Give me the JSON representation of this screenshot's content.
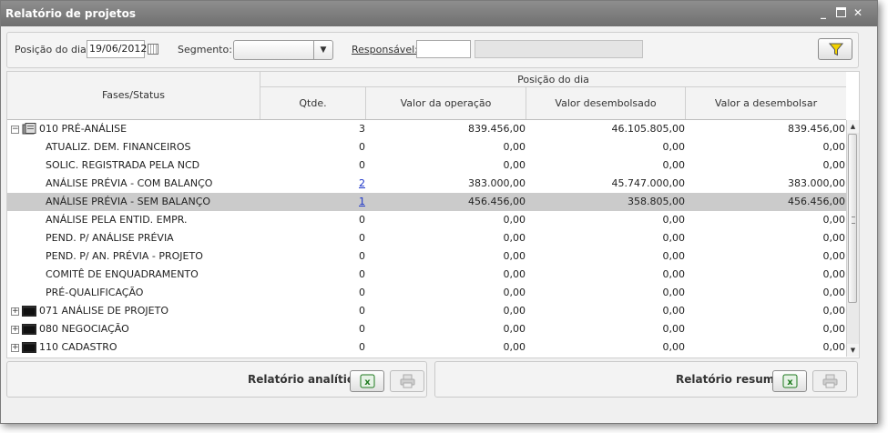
{
  "window": {
    "title": "Relatório de projetos"
  },
  "filters": {
    "posicao_label": "Posição do dia:",
    "posicao_value": "19/06/2012",
    "segmento_label": "Segmento:",
    "segmento_value": "",
    "responsavel_label": "Responsável:",
    "responsavel_code": "",
    "responsavel_name": ""
  },
  "grid": {
    "headers": {
      "fases": "Fases/Status",
      "posicao": "Posição do dia",
      "qtde": "Qtde.",
      "valor_operacao": "Valor da operação",
      "valor_desembolsado": "Valor desembolsado",
      "valor_a_desembolsar": "Valor a desembolsar"
    },
    "rows": [
      {
        "type": "group",
        "expander": "−",
        "name": "010 PRÉ-ANÁLISE",
        "qtde": "3",
        "op": "839.456,00",
        "des": "46.105.805,00",
        "ades": "839.456,00",
        "bold": true
      },
      {
        "type": "child",
        "name": "ATUALIZ. DEM. FINANCEIROS",
        "qtde": "0",
        "op": "0,00",
        "des": "0,00",
        "ades": "0,00"
      },
      {
        "type": "child",
        "name": "SOLIC. REGISTRADA PELA NCD",
        "qtde": "0",
        "op": "0,00",
        "des": "0,00",
        "ades": "0,00"
      },
      {
        "type": "child",
        "name": "ANÁLISE PRÉVIA - COM BALANÇO",
        "qtde": "2",
        "op": "383.000,00",
        "des": "45.747.000,00",
        "ades": "383.000,00",
        "link": true
      },
      {
        "type": "child",
        "name": "ANÁLISE PRÉVIA - SEM BALANÇO",
        "qtde": "1",
        "op": "456.456,00",
        "des": "358.805,00",
        "ades": "456.456,00",
        "link": true,
        "selected": true
      },
      {
        "type": "child",
        "name": "ANÁLISE PELA ENTID. EMPR.",
        "qtde": "0",
        "op": "0,00",
        "des": "0,00",
        "ades": "0,00"
      },
      {
        "type": "child",
        "name": "PEND. P/ ANÁLISE PRÉVIA",
        "qtde": "0",
        "op": "0,00",
        "des": "0,00",
        "ades": "0,00"
      },
      {
        "type": "child",
        "name": "PEND. P/ AN. PRÉVIA - PROJETO",
        "qtde": "0",
        "op": "0,00",
        "des": "0,00",
        "ades": "0,00"
      },
      {
        "type": "child",
        "name": "COMITÊ DE ENQUADRAMENTO",
        "qtde": "0",
        "op": "0,00",
        "des": "0,00",
        "ades": "0,00"
      },
      {
        "type": "child",
        "name": "PRÉ-QUALIFICAÇÃO",
        "qtde": "0",
        "op": "0,00",
        "des": "0,00",
        "ades": "0,00"
      },
      {
        "type": "group",
        "expander": "+",
        "name": "071 ANÁLISE DE PROJETO",
        "qtde": "0",
        "op": "0,00",
        "des": "0,00",
        "ades": "0,00"
      },
      {
        "type": "group",
        "expander": "+",
        "name": "080 NEGOCIAÇÃO",
        "qtde": "0",
        "op": "0,00",
        "des": "0,00",
        "ades": "0,00"
      },
      {
        "type": "group",
        "expander": "+",
        "name": "110 CADASTRO",
        "qtde": "0",
        "op": "0,00",
        "des": "0,00",
        "ades": "0,00"
      }
    ]
  },
  "footer": {
    "analitico_label": "Relatório analítico",
    "resumo_label": "Relatório resumo"
  },
  "colors": {
    "titlebar": "#7f7f7f",
    "link": "#1a33c8",
    "selected_row": "#cbcbcb",
    "filter_icon": "#f2d200",
    "excel_icon": "#1f7a1f"
  }
}
